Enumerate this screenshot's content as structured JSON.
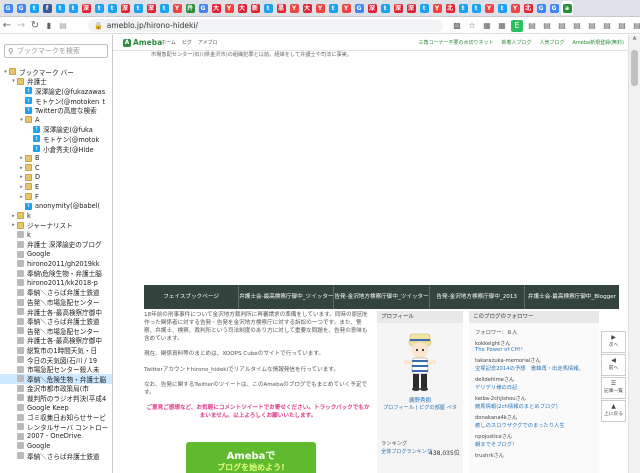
{
  "tabs": [
    {
      "icon": "G",
      "color": "#4285f4"
    },
    {
      "icon": "G",
      "color": "#4285f4"
    },
    {
      "icon": "t",
      "color": "#1da1f2"
    },
    {
      "icon": "f",
      "color": "#3b5998"
    },
    {
      "icon": "t",
      "color": "#1da1f2"
    },
    {
      "icon": "t",
      "color": "#1da1f2"
    },
    {
      "icon": "深",
      "color": "#d23"
    },
    {
      "icon": "t",
      "color": "#1da1f2"
    },
    {
      "icon": "t",
      "color": "#1da1f2"
    },
    {
      "icon": "深",
      "color": "#d23"
    },
    {
      "icon": "t",
      "color": "#1da1f2"
    },
    {
      "icon": "深",
      "color": "#d23"
    },
    {
      "icon": "t",
      "color": "#1da1f2"
    },
    {
      "icon": "Y",
      "color": "#e44"
    },
    {
      "icon": "弁",
      "color": "#2d8c3c"
    },
    {
      "icon": "G",
      "color": "#4285f4"
    },
    {
      "icon": "大",
      "color": "#d23"
    },
    {
      "icon": "Y",
      "color": "#e44"
    },
    {
      "icon": "大",
      "color": "#d23"
    },
    {
      "icon": "新",
      "color": "#d23"
    },
    {
      "icon": "t",
      "color": "#1da1f2"
    },
    {
      "icon": "黒",
      "color": "#d23"
    },
    {
      "icon": "Y",
      "color": "#e44"
    },
    {
      "icon": "大",
      "color": "#d23"
    },
    {
      "icon": "Y",
      "color": "#e44"
    },
    {
      "icon": "t",
      "color": "#1da1f2"
    },
    {
      "icon": "Y",
      "color": "#e44"
    },
    {
      "icon": "G",
      "color": "#4285f4"
    },
    {
      "icon": "深",
      "color": "#d23"
    },
    {
      "icon": "t",
      "color": "#1da1f2"
    },
    {
      "icon": "深",
      "color": "#d23"
    },
    {
      "icon": "深",
      "color": "#d23"
    },
    {
      "icon": "t",
      "color": "#1da1f2"
    },
    {
      "icon": "Y",
      "color": "#e44"
    },
    {
      "icon": "北",
      "color": "#d23"
    },
    {
      "icon": "t",
      "color": "#1da1f2"
    },
    {
      "icon": "t",
      "color": "#1da1f2"
    },
    {
      "icon": "Y",
      "color": "#e44"
    },
    {
      "icon": "t",
      "color": "#1da1f2"
    },
    {
      "icon": "Y",
      "color": "#e44"
    },
    {
      "icon": "北",
      "color": "#d23"
    },
    {
      "icon": "G",
      "color": "#4285f4"
    },
    {
      "icon": "G",
      "color": "#4285f4"
    },
    {
      "icon": "a",
      "color": "#2d8c3c",
      "active": true
    }
  ],
  "address": {
    "url": "ameblo.jp/hirono-hideki/"
  },
  "sidebar": {
    "search_placeholder": "ブックマークを検索",
    "items": [
      {
        "label": "ブックマーク バー",
        "indent": 0,
        "arrow": "▾",
        "icon": "folder"
      },
      {
        "label": "弁護士",
        "indent": 1,
        "arrow": "▾",
        "icon": "folder"
      },
      {
        "label": "深澤諭史(@fukazawas",
        "indent": 2,
        "arrow": "",
        "icon": "twit"
      },
      {
        "label": "モトケン(@motoken_t",
        "indent": 2,
        "arrow": "",
        "icon": "twit"
      },
      {
        "label": "Twitterの高度な検索",
        "indent": 2,
        "arrow": "",
        "icon": "twit"
      },
      {
        "label": "A",
        "indent": 2,
        "arrow": "▾",
        "icon": "folder"
      },
      {
        "label": "深澤諭史(@fuka",
        "indent": 3,
        "arrow": "",
        "icon": "twit"
      },
      {
        "label": "モトケン(@motok",
        "indent": 3,
        "arrow": "",
        "icon": "twit"
      },
      {
        "label": "小倉秀夫(@Hide",
        "indent": 3,
        "arrow": "",
        "icon": "twit"
      },
      {
        "label": "B",
        "indent": 2,
        "arrow": "▸",
        "icon": "folder"
      },
      {
        "label": "C",
        "indent": 2,
        "arrow": "▸",
        "icon": "folder"
      },
      {
        "label": "D",
        "indent": 2,
        "arrow": "▸",
        "icon": "folder"
      },
      {
        "label": "E",
        "indent": 2,
        "arrow": "▸",
        "icon": "folder"
      },
      {
        "label": "F",
        "indent": 2,
        "arrow": "▸",
        "icon": "folder"
      },
      {
        "label": "anonymity(@babel(",
        "indent": 2,
        "arrow": "",
        "icon": "twit"
      },
      {
        "label": "k",
        "indent": 1,
        "arrow": "▸",
        "icon": "folder"
      },
      {
        "label": "ジャーナリスト",
        "indent": 1,
        "arrow": "▸",
        "icon": "folder"
      },
      {
        "label": "k",
        "indent": 1,
        "arrow": "",
        "icon": "web"
      },
      {
        "label": "弁護士 深澤諭史のブログ",
        "indent": 1,
        "arrow": "",
        "icon": "web"
      },
      {
        "label": "Google",
        "indent": 1,
        "arrow": "",
        "icon": "web"
      },
      {
        "label": "hirono2011/gh2019kk",
        "indent": 1,
        "arrow": "",
        "icon": "web"
      },
      {
        "label": "奉納\\危険生物・弁護士脳",
        "indent": 1,
        "arrow": "",
        "icon": "web"
      },
      {
        "label": "hirono2011/kk2018-p",
        "indent": 1,
        "arrow": "",
        "icon": "web"
      },
      {
        "label": "奉納＼さらば弁護士鉄道",
        "indent": 1,
        "arrow": "",
        "icon": "web"
      },
      {
        "label": "告発＼市場急配センター",
        "indent": 1,
        "arrow": "",
        "icon": "web"
      },
      {
        "label": "弁護士各-最高検察庁御中",
        "indent": 1,
        "arrow": "",
        "icon": "web"
      },
      {
        "label": "奉納＼さらば弁護士鉄道",
        "indent": 1,
        "arrow": "",
        "icon": "web"
      },
      {
        "label": "告発＼市場急配センター",
        "indent": 1,
        "arrow": "",
        "icon": "web"
      },
      {
        "label": "弁護士各-最高検察庁御中",
        "indent": 1,
        "arrow": "",
        "icon": "web"
      },
      {
        "label": "総覧市の1時間天気・日",
        "indent": 1,
        "arrow": "",
        "icon": "web"
      },
      {
        "label": "今日の天気図(石川 / 19",
        "indent": 1,
        "arrow": "",
        "icon": "web"
      },
      {
        "label": "市場急配センター殺人未",
        "indent": 1,
        "arrow": "",
        "icon": "web"
      },
      {
        "label": "奉納＼危険生物・弁護士脳",
        "indent": 1,
        "arrow": "",
        "icon": "web",
        "selected": true
      },
      {
        "label": "金沢市都市政策局(市",
        "indent": 1,
        "arrow": "",
        "icon": "web"
      },
      {
        "label": "裁判所のラジオ判決(平成4",
        "indent": 1,
        "arrow": "",
        "icon": "web"
      },
      {
        "label": "Google Keep",
        "indent": 1,
        "arrow": "",
        "icon": "web"
      },
      {
        "label": "ゴミ収集日お知らせサービ",
        "indent": 1,
        "arrow": "",
        "icon": "web"
      },
      {
        "label": "レンタルサーバ コントロー",
        "indent": 1,
        "arrow": "",
        "icon": "web"
      },
      {
        "label": "2007 - OneDrive",
        "indent": 1,
        "arrow": "",
        "icon": "web"
      },
      {
        "label": "Google",
        "indent": 1,
        "arrow": "",
        "icon": "web"
      },
      {
        "label": "奉納＼さらば弁護士鉄道",
        "indent": 1,
        "arrow": "",
        "icon": "web"
      }
    ]
  },
  "ameba": {
    "logo": "Ameba",
    "nav": [
      "ホーム",
      "ピグ",
      "アメブロ"
    ],
    "menu": [
      "三角コーナー不要の水切りネット",
      "新着人ブログ",
      "人気ブログ",
      "Ameba新規登録(無料)"
    ],
    "intro": "市場急配センター(石川県金沢市)の組織犯罪と以前。経緯をして弁護士や司法に事実。"
  },
  "navbar": [
    "フェイスブックページ",
    "弁護士会-最高検察庁御中_ツイッター",
    "告発-金沢地方検察庁御中_ツイッター",
    "告発-金沢地方検察庁御中_2013",
    "弁護士会-最高検察庁御中_Blogger"
  ],
  "article": {
    "p1": "18年前の刑事事件について金沢地方裁判所に再審請求の準備をしています。同時の原因を作った関係者に対する告発・告発を金沢地方検察庁に対する訴訟の一つです。また、警察、弁護士、検察、裁判所という司法制度のあり方に対して重要な問題を、告発の意味も含めています。",
    "p2": "現在、関係資料等のまとめは、XOOPS Cubeのサイトで行っています。",
    "p3": "Twitterアカウントhirono_hidekiでリアルタイムな情報発信を行っています。",
    "p4": "なお、告発に関するTwitterのツイートは、このAmebaのブログでもまとめていく予定です。",
    "notice": "ご意見ご感想など、お気軽にコメントツイートでお寄せください。トラックバックでもかまいません。以上よろしくお願いいたします。"
  },
  "banner": {
    "line1": "Amebaで",
    "line2": "ブログを始めよう!"
  },
  "profile": {
    "title": "プロフィール",
    "name": "廣野秀樹",
    "link": "プロフィール | ピグの部屋 ペタ",
    "rank_label": "ランキング",
    "rank_sub": "全体ブログランキング",
    "rank_value": "438,035位"
  },
  "followers": {
    "title": "このブログのフォロワー",
    "count": "フォロワー：８人",
    "list": [
      {
        "user": "kokkeightさん",
        "title": "The Power of CH!!"
      },
      {
        "user": "takarazuka-memorialさん",
        "title": "宝塚記念2014の予想　書籍再・出走馬情報。"
      },
      {
        "user": "delldehimeさん",
        "title": "デリデリ様の日記"
      },
      {
        "user": "keiba-2chjishouさん",
        "title": "競馬情報(2ch情報のまとめブログ)"
      },
      {
        "user": "donakana4kさん",
        "title": "癒しのスロウザクグでのまったり人生"
      },
      {
        "user": "npojusticeさん",
        "title": "朝までそブログ!"
      },
      {
        "user": "trushrkさん",
        "title": ""
      }
    ]
  },
  "sidenav": [
    "次へ",
    "前へ",
    "記事一覧",
    "上に戻る"
  ]
}
